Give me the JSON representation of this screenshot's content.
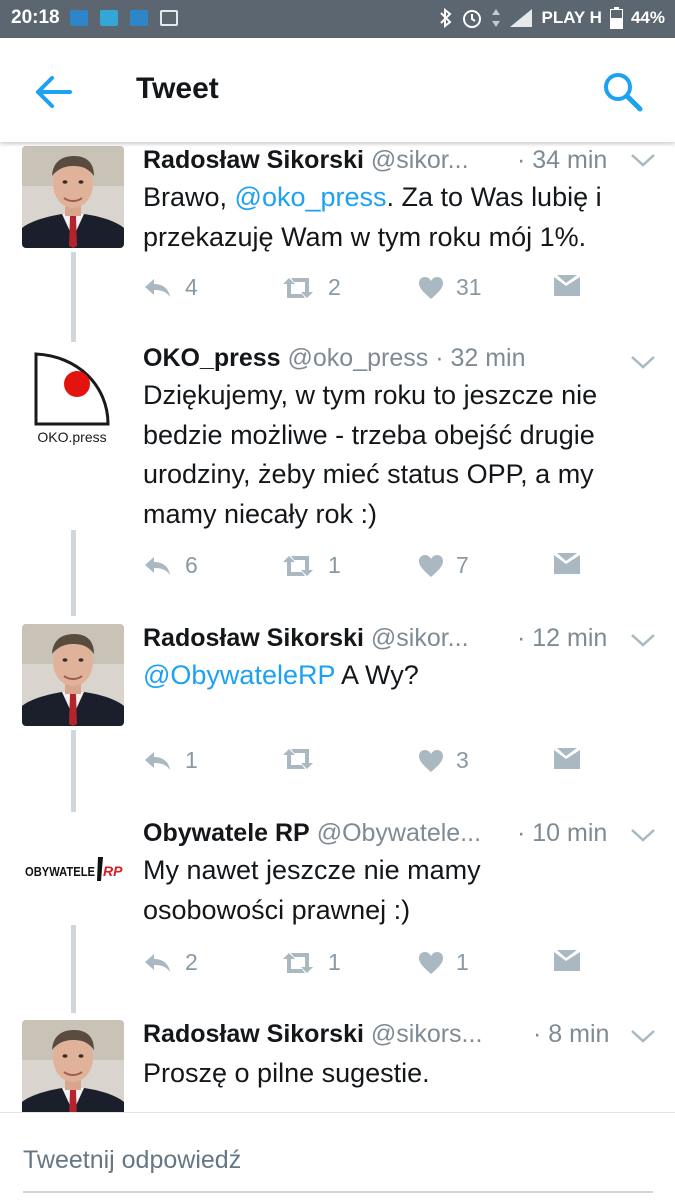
{
  "status_bar": {
    "time": "20:18",
    "carrier": "PLAY H",
    "battery": "44%",
    "icons": [
      "bluetooth-icon",
      "alarm-icon",
      "data-arrows-icon",
      "signal-icon",
      "battery-icon"
    ]
  },
  "header": {
    "title": "Tweet",
    "back_icon": "arrow-left-icon",
    "search_icon": "search-icon",
    "accent_color": "#1da1f2"
  },
  "tweets": [
    {
      "name": "Radosław Sikorski",
      "handle": "@sikor...",
      "time": "· 34 min",
      "avatar": "sikorski-avatar",
      "text_plain": "Brawo, ",
      "mention": "@oko_press",
      "text_after": ".  Za to Was lubię i przekazuję Wam w tym roku mój 1%.",
      "replies": "4",
      "retweets": "2",
      "likes": "31"
    },
    {
      "name": "OKO_press",
      "handle": "@oko_press",
      "time": "· 32 min",
      "avatar": "oko-press-logo",
      "avatar_label": "OKO.press",
      "text_plain": "Dziękujemy, w tym roku to jeszcze nie bedzie możliwe - trzeba obejść drugie urodziny, żeby mieć status OPP, a my mamy niecały rok :)",
      "mention": "",
      "text_after": "",
      "replies": "6",
      "retweets": "1",
      "likes": "7"
    },
    {
      "name": "Radosław Sikorski",
      "handle": "@sikor...",
      "time": "· 12 min",
      "avatar": "sikorski-avatar",
      "text_plain": "",
      "mention": "@ObywateleRP",
      "text_after": " A Wy?",
      "replies": "1",
      "retweets": "",
      "likes": "3"
    },
    {
      "name": "Obywatele RP",
      "handle": "@Obywatele...",
      "time": "· 10 min",
      "avatar": "obywatele-rp-logo",
      "avatar_label_a": "OBYWATELE",
      "avatar_label_b": "RP",
      "text_plain": "My nawet jeszcze nie mamy osobowości prawnej :)",
      "mention": "",
      "text_after": "",
      "replies": "2",
      "retweets": "1",
      "likes": "1"
    },
    {
      "name": "Radosław Sikorski",
      "handle": "@sikors...",
      "time": "· 8 min",
      "avatar": "sikorski-avatar",
      "text_plain": "Proszę o pilne sugestie.",
      "mention": "",
      "text_after": "",
      "replies": "",
      "retweets": "",
      "likes": ""
    }
  ],
  "compose": {
    "placeholder": "Tweetnij odpowiedź"
  }
}
